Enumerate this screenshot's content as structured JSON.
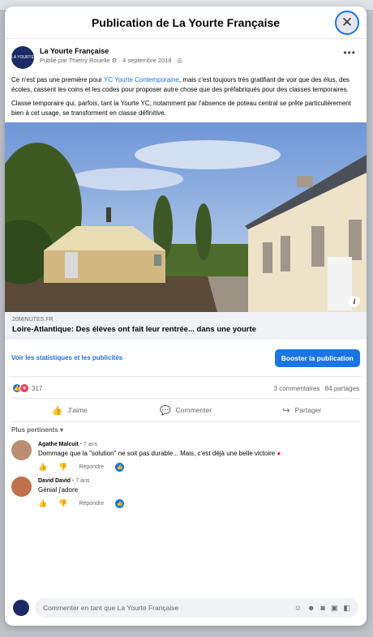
{
  "modal": {
    "title": "Publication de La Yourte Française",
    "close_icon": "close-icon"
  },
  "post": {
    "author": "La Yourte Française",
    "avatar_label": "LA YOURTE",
    "published_by": "Publié par Thierry Rouelle",
    "date": "4 septembre 2018",
    "paragraph1": {
      "before": "Ce n'est pas une première pour ",
      "link": "YC Yourte Contemporaine",
      "after": ", mais c'est toujours très gratifiant de voir que des élus, des écoles, cassent les coins et les codes pour proposer autre chose que des préfabriqués pour des classes temporaires."
    },
    "paragraph2": "Classe temporaire qui, parfois, tant la Yourte YC, notamment par l'absence de poteau central se prête particulièrement bien à cet usage, se transforment en classe définitive.",
    "link_preview": {
      "domain": "20MINUTES.FR",
      "title": "Loire-Atlantique: Des élèves ont fait leur rentrée... dans une yourte"
    }
  },
  "stats": {
    "stats_link": "Voir les statistiques et les publicités",
    "boost_button": "Booster la publication"
  },
  "reactions": {
    "count": "317",
    "comments": "3 commentaires",
    "shares": "84 partages"
  },
  "actions": {
    "like": "J'aime",
    "comment": "Commenter",
    "share": "Partager"
  },
  "comments_sort": "Plus pertinents",
  "comments": [
    {
      "author": "Agathe Malcuit",
      "time": "7 ans",
      "text": "Dommage que la \"solution\" ne soit pas durable... Mais, c'est déjà une belle victoire",
      "reply": "Répondre"
    },
    {
      "author": "David David",
      "time": "7 ans",
      "text": "Génial j'adore",
      "reply": "Répondre"
    }
  ],
  "composer": {
    "placeholder": "Commenter en tant que La Yourte Française"
  },
  "colors": {
    "accent": "#1b74e4",
    "link": "#216fdb",
    "love": "#f33e58"
  }
}
